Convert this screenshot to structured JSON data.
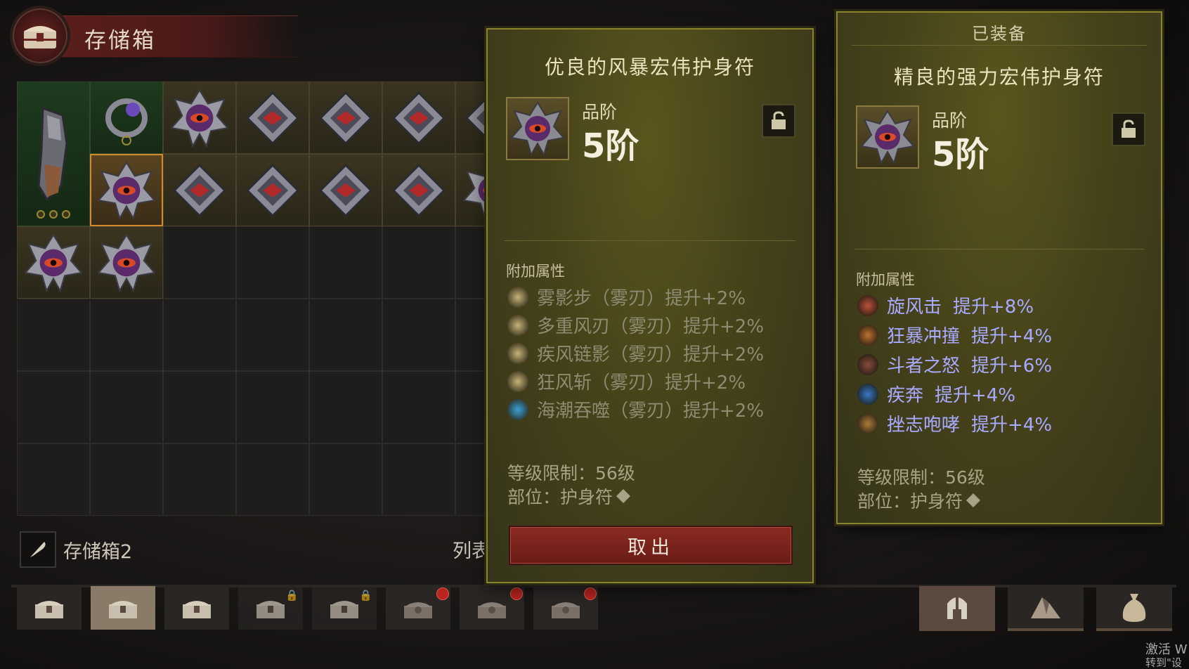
{
  "header": {
    "title": "存储箱"
  },
  "stash": {
    "name": "存储箱2",
    "list_label": "列表"
  },
  "compare_card": {
    "title": "优良的风暴宏伟护身符",
    "tier_label": "品阶",
    "tier_value": "5阶",
    "affix_section": "附加属性",
    "affixes": [
      {
        "text": "雾影步（雾刃）提升+2%",
        "icon": "mist-step-icon",
        "color": "#c8b47a"
      },
      {
        "text": "多重风刃（雾刃）提升+2%",
        "icon": "multi-blade-icon",
        "color": "#c8b47a"
      },
      {
        "text": "疾风链影（雾刃）提升+2%",
        "icon": "gale-chain-icon",
        "color": "#c8b47a"
      },
      {
        "text": "狂风斩（雾刃）提升+2%",
        "icon": "gale-slash-icon",
        "color": "#c8b47a"
      },
      {
        "text": "海潮吞噬（雾刃）提升+2%",
        "icon": "tide-devour-icon",
        "color": "#3aa0d8"
      }
    ],
    "level_req": "等级限制：56级",
    "slot": "部位：护身符",
    "withdraw_label": "取出"
  },
  "equipped_card": {
    "equipped_label": "已装备",
    "title": "精良的强力宏伟护身符",
    "tier_label": "品阶",
    "tier_value": "5阶",
    "affix_section": "附加属性",
    "affixes": [
      {
        "skill": "旋风击",
        "bonus": "提升+8%",
        "icon": "whirlwind-icon",
        "color": "#c0503a"
      },
      {
        "skill": "狂暴冲撞",
        "bonus": "提升+4%",
        "icon": "frenzy-charge-icon",
        "color": "#c07030"
      },
      {
        "skill": "斗者之怒",
        "bonus": "提升+6%",
        "icon": "fighter-rage-icon",
        "color": "#8a4a3a"
      },
      {
        "skill": "疾奔",
        "bonus": "提升+4%",
        "icon": "sprint-icon",
        "color": "#3a78c8"
      },
      {
        "skill": "挫志咆哮",
        "bonus": "提升+4%",
        "icon": "demoralize-roar-icon",
        "color": "#b07a3a"
      }
    ],
    "level_req": "等级限制：56级",
    "slot": "部位：护身符"
  },
  "watermark": {
    "line1": "激活 W",
    "line2": "转到\"设置"
  },
  "colors": {
    "affix_blue": "#a8aaff",
    "accent_gold": "#8a842e",
    "button_red": "#8a2a22"
  }
}
